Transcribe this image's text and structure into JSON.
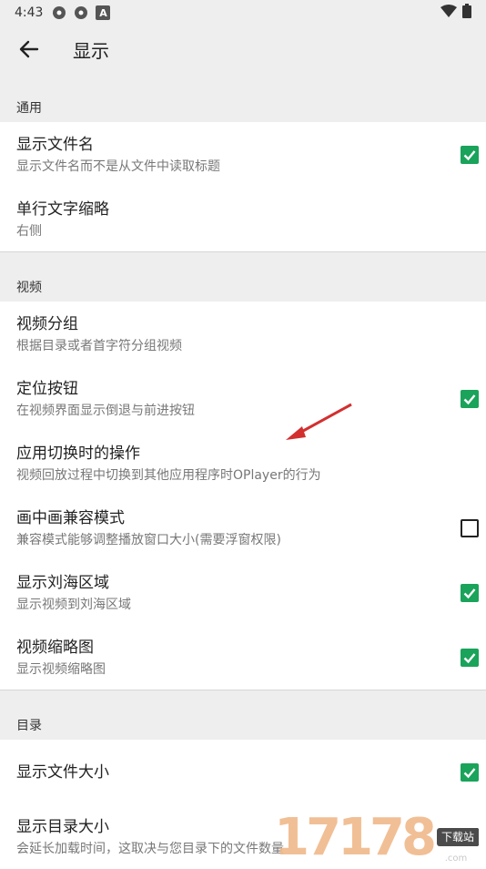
{
  "status": {
    "time": "4:43",
    "indicator": "A"
  },
  "toolbar": {
    "title": "显示"
  },
  "sections": [
    {
      "header": "通用",
      "items": [
        {
          "title": "显示文件名",
          "subtitle": "显示文件名而不是从文件中读取标题",
          "checkbox": true
        },
        {
          "title": "单行文字缩略",
          "subtitle": "右侧",
          "checkbox": null
        }
      ]
    },
    {
      "header": "视频",
      "items": [
        {
          "title": "视频分组",
          "subtitle": "根据目录或者首字符分组视频",
          "checkbox": null
        },
        {
          "title": "定位按钮",
          "subtitle": "在视频界面显示倒退与前进按钮",
          "checkbox": true
        },
        {
          "title": "应用切换时的操作",
          "subtitle": "视频回放过程中切换到其他应用程序时OPlayer的行为",
          "checkbox": null
        },
        {
          "title": "画中画兼容模式",
          "subtitle": "兼容模式能够调整播放窗口大小(需要浮窗权限)",
          "checkbox": false
        },
        {
          "title": "显示刘海区域",
          "subtitle": "显示视频到刘海区域",
          "checkbox": true
        },
        {
          "title": "视频缩略图",
          "subtitle": "显示视频缩略图",
          "checkbox": true
        }
      ]
    },
    {
      "header": "目录",
      "items": [
        {
          "title": "显示文件大小",
          "subtitle": "",
          "checkbox": true
        },
        {
          "title": "显示目录大小",
          "subtitle": "会延长加载时间，这取决与您目录下的文件数量",
          "checkbox": false
        }
      ]
    }
  ],
  "watermark": {
    "number": "17178",
    "label": "下载站",
    "domain": ".com"
  },
  "colors": {
    "check": "#1aa35a",
    "background": "#eeeeee",
    "annotation_arrow": "#d32f2f"
  }
}
